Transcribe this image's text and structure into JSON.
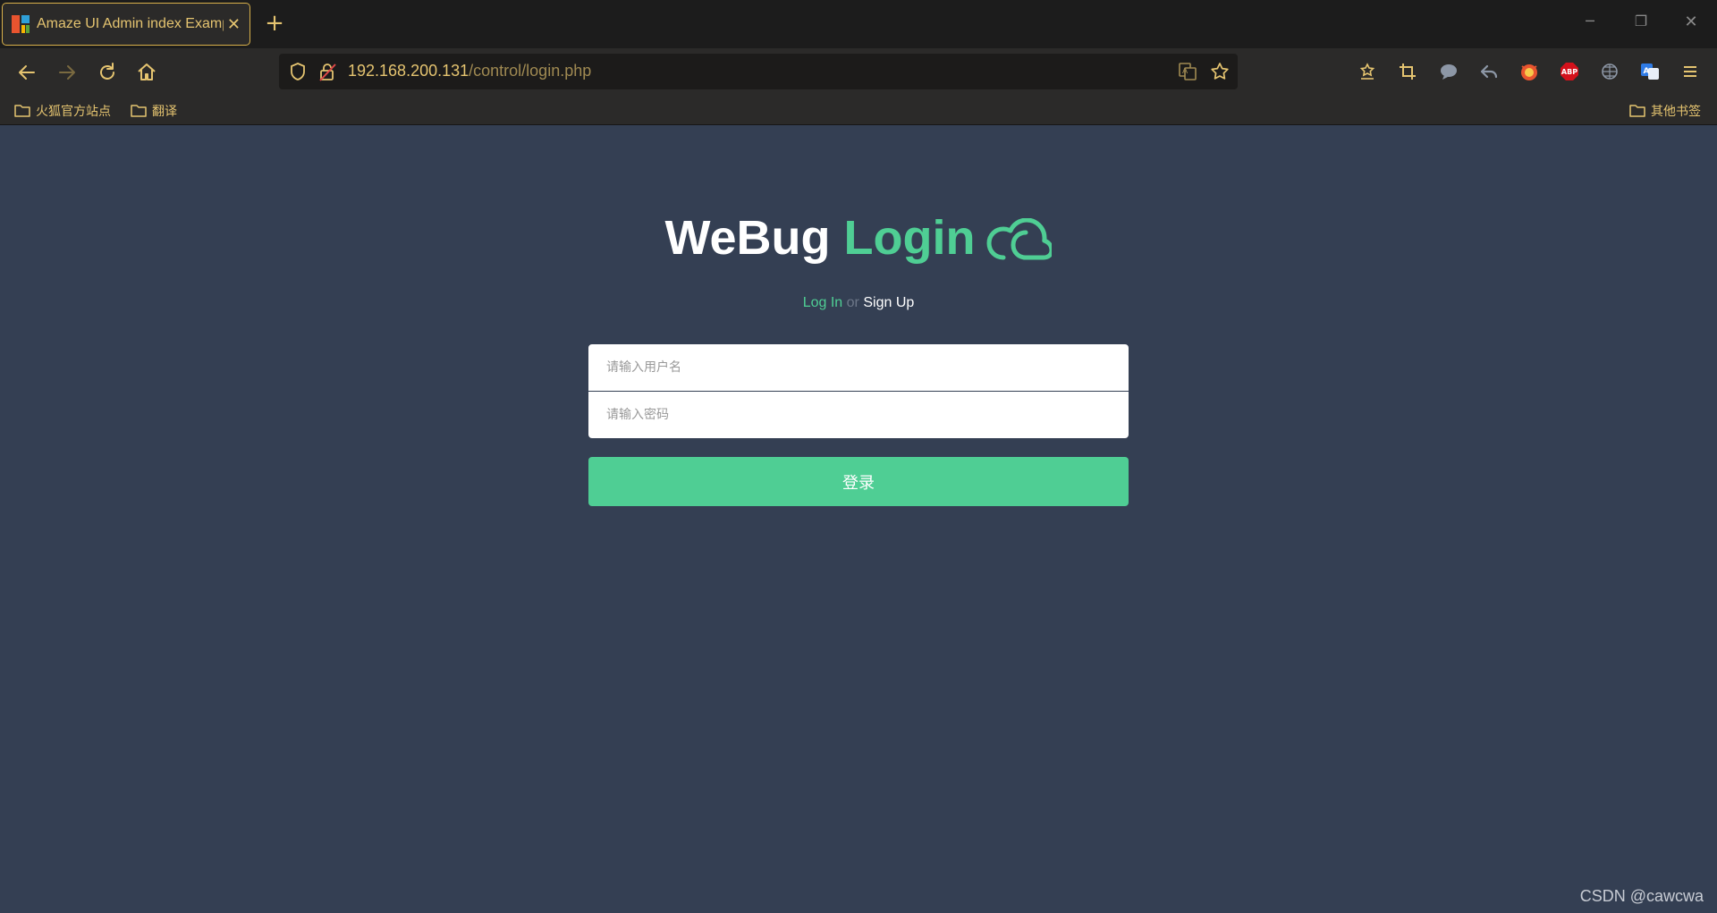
{
  "browser": {
    "tab_title": "Amaze UI Admin index Example",
    "new_tab_label": "+",
    "url_host": "192.168.200.131",
    "url_path": "/control/login.php",
    "bookmarks": [
      {
        "label": "火狐官方站点"
      },
      {
        "label": "翻译"
      }
    ],
    "other_bookmarks": "其他书签",
    "accent_color": "#e5c470"
  },
  "page": {
    "title_part1": "WeBug",
    "title_part2": "Login",
    "login_link": "Log In",
    "or_text": "or",
    "signup_link": "Sign Up",
    "username_placeholder": "请输入用户名",
    "password_placeholder": "请输入密码",
    "submit_label": "登录",
    "background_color": "#343f53",
    "accent_color": "#4fce94"
  },
  "watermark": "CSDN @cawcwa"
}
